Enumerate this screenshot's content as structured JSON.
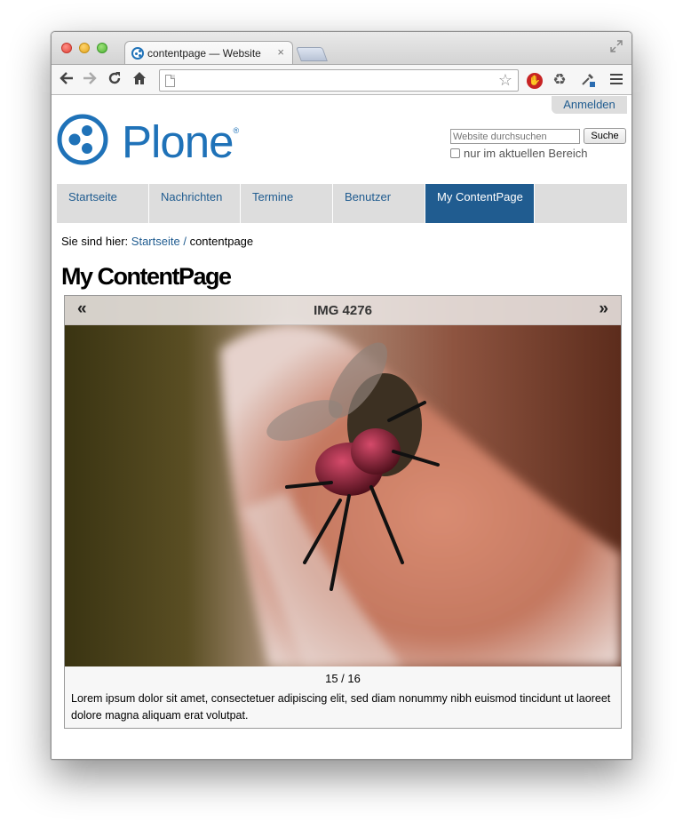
{
  "browser": {
    "tab_title": "contentpage — Website",
    "tab_close": "×",
    "address": ""
  },
  "site": {
    "login_label": "Anmelden",
    "logo_text": "Plone",
    "logo_reg": "®",
    "search_placeholder": "Website durchsuchen",
    "search_button": "Suche",
    "scope_label": "nur im aktuellen Bereich"
  },
  "nav": {
    "items": [
      {
        "label": "Startseite"
      },
      {
        "label": "Nachrichten"
      },
      {
        "label": "Termine"
      },
      {
        "label": "Benutzer"
      },
      {
        "label": "My ContentPage"
      }
    ]
  },
  "breadcrumb": {
    "prefix": "Sie sind hier:",
    "home": "Startseite",
    "separator": "/",
    "current": "contentpage"
  },
  "page": {
    "title": "My ContentPage"
  },
  "gallery": {
    "prev": "«",
    "next": "»",
    "image_title": "IMG 4276",
    "counter": "15 / 16",
    "caption": "Lorem ipsum dolor sit amet, consectetuer adipiscing elit, sed diam nonummy nibh euismod tincidunt ut laoreet dolore magna aliquam erat volutpat."
  },
  "colors": {
    "plone_blue": "#1f72b8",
    "nav_active": "#205c90",
    "nav_bg": "#dddddd"
  }
}
